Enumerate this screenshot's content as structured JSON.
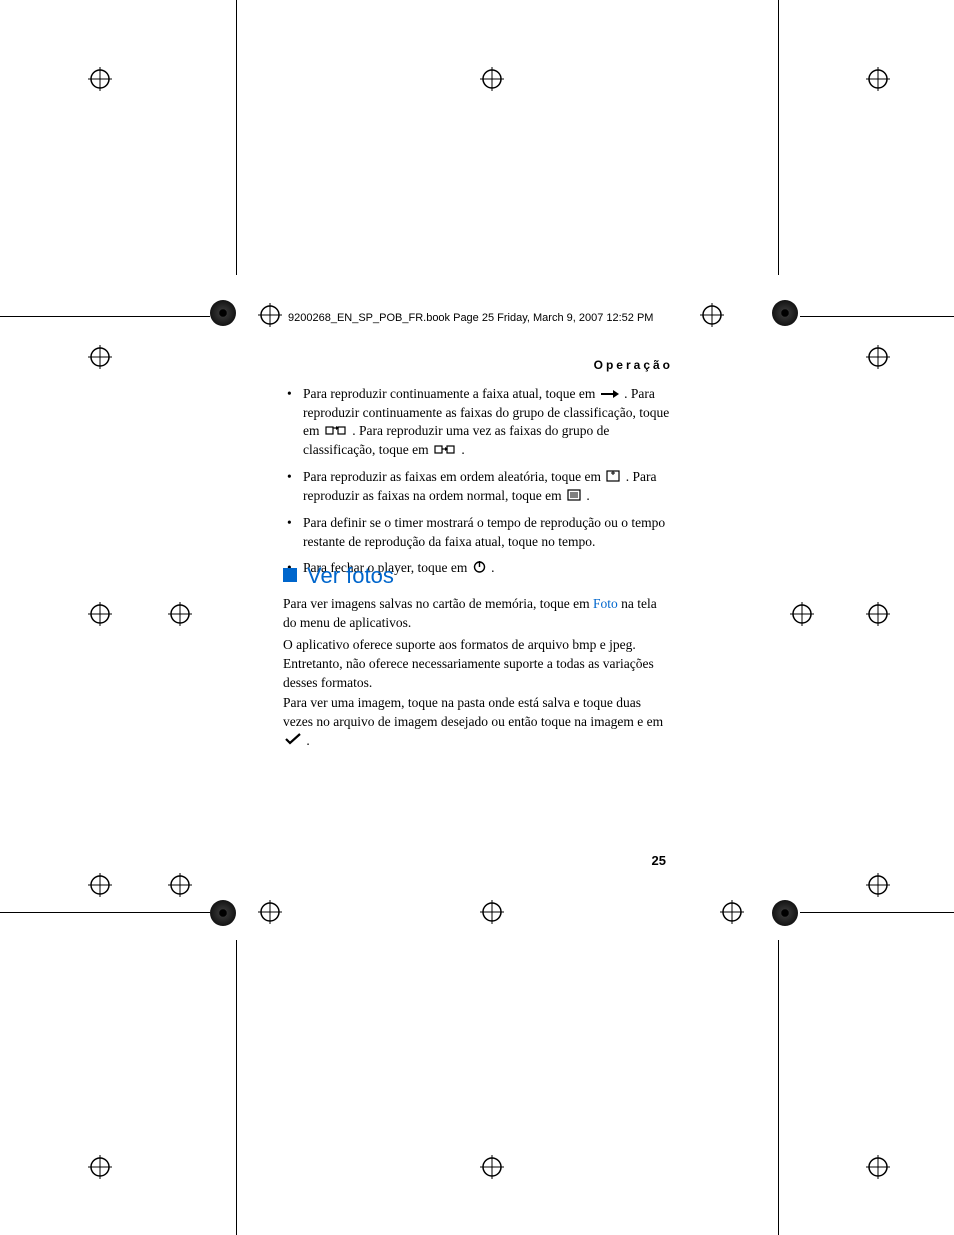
{
  "header": {
    "book_info": "9200268_EN_SP_POB_FR.book  Page 25  Friday, March 9, 2007  12:52 PM"
  },
  "running_header": "Operação",
  "bullets": {
    "b1_a": "Para reproduzir continuamente a faixa atual, toque em ",
    "b1_b": ". Para reproduzir continuamente as faixas do grupo de classificação, toque em ",
    "b1_c": ". Para reproduzir uma vez as faixas do grupo de classificação, toque em ",
    "b1_d": ".",
    "b2_a": "Para reproduzir as faixas em ordem aleatória, toque em ",
    "b2_b": ". Para reproduzir as faixas na ordem normal, toque em ",
    "b2_c": ".",
    "b3": "Para definir se o timer mostrará o tempo de reprodução ou o tempo restante de reprodução da faixa atual, toque no tempo.",
    "b4_a": "Para fechar o player, toque em ",
    "b4_b": "."
  },
  "section": {
    "title": "Ver fotos",
    "p1_a": "Para ver imagens salvas no cartão de memória, toque em ",
    "p1_link": "Foto",
    "p1_b": " na tela do menu de aplicativos.",
    "p2": "O aplicativo oferece suporte aos formatos de arquivo bmp e jpeg. Entretanto, não oferece necessariamente suporte a todas as variações desses formatos.",
    "p3_a": "Para ver uma imagem, toque na pasta onde está salva e toque duas vezes no arquivo de imagem desejado ou então toque na imagem e em ",
    "p3_b": "."
  },
  "page_number": "25"
}
